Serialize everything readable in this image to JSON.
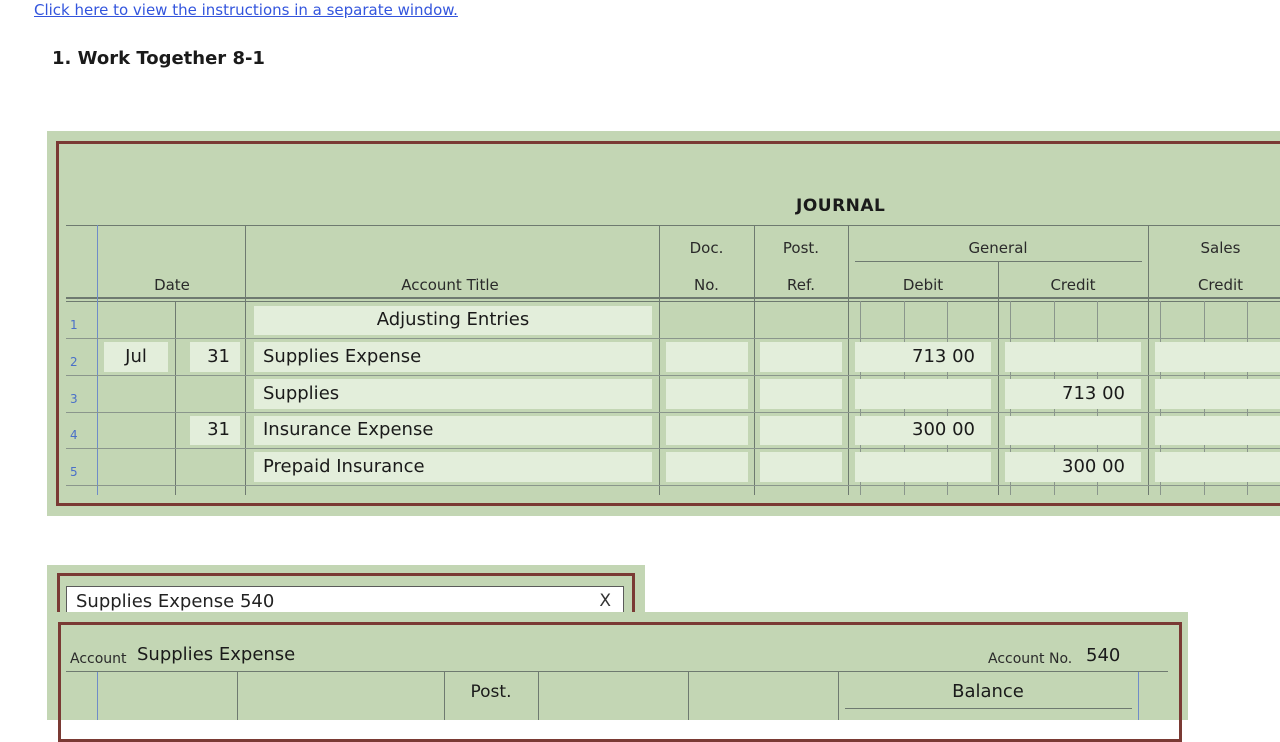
{
  "link": {
    "instructions": "Click here to view the instructions in a separate window."
  },
  "heading": {
    "title": "1.  Work Together 8-1"
  },
  "journal": {
    "title": "JOURNAL",
    "headers": {
      "date": "Date",
      "account_title": "Account Title",
      "doc_top": "Doc.",
      "doc_bottom": "No.",
      "post_top": "Post.",
      "post_bottom": "Ref.",
      "general": "General",
      "debit": "Debit",
      "credit": "Credit",
      "sales_top": "Sales",
      "sales_bottom": "Credit"
    },
    "rows": [
      {
        "num": "1",
        "month": "",
        "day": "",
        "account": "Adjusting Entries",
        "debit": "",
        "credit": ""
      },
      {
        "num": "2",
        "month": "Jul",
        "day": "31",
        "account": "Supplies Expense",
        "debit": "713 00",
        "credit": ""
      },
      {
        "num": "3",
        "month": "",
        "day": "",
        "account": "Supplies",
        "debit": "",
        "credit": "713 00"
      },
      {
        "num": "4",
        "month": "",
        "day": "31",
        "account": "Insurance Expense",
        "debit": "300 00",
        "credit": ""
      },
      {
        "num": "5",
        "month": "",
        "day": "",
        "account": "Prepaid Insurance",
        "debit": "",
        "credit": "300 00"
      }
    ]
  },
  "ledger": {
    "tab_label": "Supplies Expense 540",
    "close": "X",
    "account_label": "Account",
    "account_name": "Supplies Expense",
    "account_no_label": "Account No.",
    "account_no": "540",
    "post_header": "Post.",
    "balance_header": "Balance"
  }
}
